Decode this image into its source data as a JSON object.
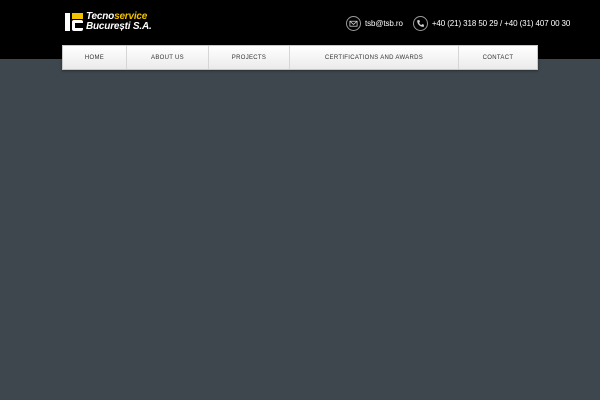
{
  "header": {
    "logo": {
      "line1_prefix": "Tecno",
      "line1_accent": "service",
      "line2": "București S.A."
    },
    "email_icon": "envelope-icon",
    "email": "tsb@tsb.ro",
    "phone_icon": "phone-icon",
    "phone": "+40 (21) 318 50 29 / +40 (31) 407 00 30"
  },
  "nav": {
    "items": [
      {
        "label": "HOME"
      },
      {
        "label": "ABOUT US"
      },
      {
        "label": "PROJECTS"
      },
      {
        "label": "CERTIFICATIONS AND AWARDS"
      },
      {
        "label": "CONTACT"
      }
    ]
  },
  "colors": {
    "topbar": "#000000",
    "page_background": "#3d474d",
    "logo_accent": "#f2c200",
    "nav_background": "#f4f4f4"
  }
}
